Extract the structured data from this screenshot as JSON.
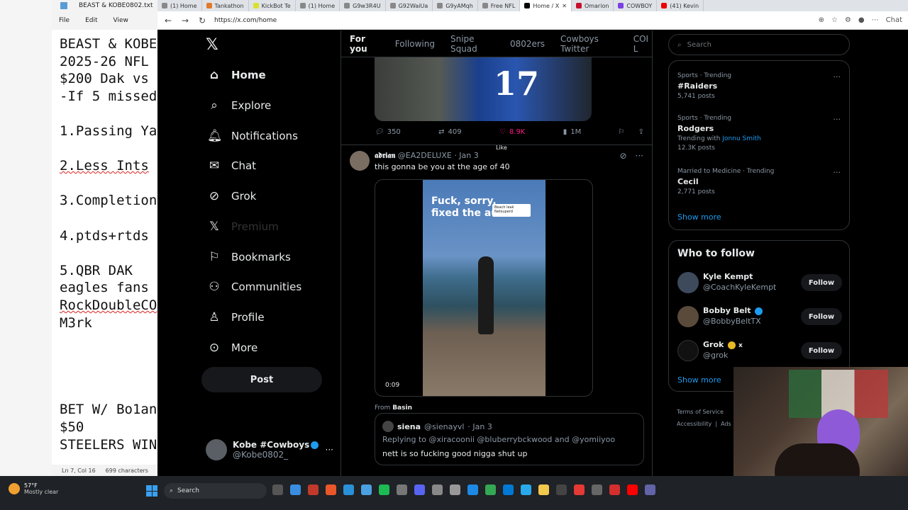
{
  "notepad": {
    "title": "BEAST & KOBE0802.txt",
    "menu": [
      "File",
      "Edit",
      "View"
    ],
    "lines": [
      "BEAST & KOBE",
      "2025-26 NFL",
      "$200 Dak vs",
      "",
      "-If 5 missed",
      "",
      "1.Passing Ya",
      "",
      "2.Less Ints",
      "",
      "3.Completion",
      "",
      "4.ptds+rtds",
      "",
      "5.QBR DAK",
      "eagles fans",
      "RockDoubleCO",
      "M3rk",
      "",
      "",
      "",
      "",
      "BET W/ Bo1an",
      "$50",
      "STEELERS WIN"
    ],
    "status_pos": "Ln 7, Col 16",
    "status_chars": "699 characters"
  },
  "browser": {
    "tabs": [
      "(1) Home",
      "Tankathon",
      "KickBot Te",
      "(1) Home",
      "G9w3R4U",
      "G92WaiUa",
      "G9yAMqh",
      "Free NFL",
      "Home / X",
      "Omarion",
      "COWBOY",
      "(41) Kevin"
    ],
    "active_tab_index": 8,
    "url": "https://x.com/home",
    "chat_label": "Chat"
  },
  "x": {
    "nav": [
      {
        "label": "Home",
        "icon": "home-icon"
      },
      {
        "label": "Explore",
        "icon": "search-icon"
      },
      {
        "label": "Notifications",
        "icon": "bell-icon"
      },
      {
        "label": "Chat",
        "icon": "mail-icon"
      },
      {
        "label": "Grok",
        "icon": "grok-icon"
      },
      {
        "label": "Premium",
        "icon": "x-icon"
      },
      {
        "label": "Bookmarks",
        "icon": "bookmark-icon"
      },
      {
        "label": "Communities",
        "icon": "communities-icon"
      },
      {
        "label": "Profile",
        "icon": "profile-icon"
      },
      {
        "label": "More",
        "icon": "more-icon"
      }
    ],
    "post_label": "Post",
    "account": {
      "name": "Kobe #Cowboys",
      "handle": "@Kobe0802_"
    },
    "tabs": [
      "For you",
      "Following",
      "Snipe Squad",
      "0802ers",
      "Cowboys Twitter",
      "COI L"
    ],
    "post1": {
      "jersey_number": "17",
      "replies": "350",
      "reposts": "409",
      "likes": "8.9K",
      "views": "1M",
      "like_tooltip": "Like"
    },
    "post2": {
      "name": "𝖆𝖉𝖗𝖎𝖆𝖓",
      "handle": "@EA2DELUXE",
      "date": "· Jan 3",
      "text": "this gonna be you at the age of 40",
      "video_caption_1": "Fuck, sorry,",
      "video_caption_2": "fixed the audio",
      "video_chip_1": "Beach leak",
      "video_chip_2": "Netsuperd",
      "video_time": "0:09",
      "from_label": "From",
      "from_source": "Basin",
      "quote": {
        "name": "siena",
        "handle": "@sienayvl",
        "date": "· Jan 3",
        "replying": "Replying to @xiracoonii @bluberrybckwood and @yomiiyoo",
        "text": "nett is so fucking good nigga shut up"
      }
    },
    "search_placeholder": "Search",
    "trends": [
      {
        "cat": "Sports · Trending",
        "name": "#Raiders",
        "ctx": "5,741 posts"
      },
      {
        "cat": "Sports · Trending",
        "name": "Rodgers",
        "ctx_prefix": "Trending with",
        "ctx_link": "Jonnu Smith",
        "ctx2": "12.3K posts"
      },
      {
        "cat": "Married to Medicine · Trending",
        "name": "Cecil",
        "ctx": "2,771 posts"
      }
    ],
    "show_more": "Show more",
    "who_to_follow_title": "Who to follow",
    "who_to_follow": [
      {
        "name": "Kyle Kempt",
        "handle": "@CoachKyleKempt",
        "button": "Follow"
      },
      {
        "name": "Bobby Belt",
        "handle": "@BobbyBeltTX",
        "button": "Follow"
      },
      {
        "name": "Grok",
        "handle": "@grok",
        "button": "Follow"
      }
    ],
    "footer": [
      "Terms of Service",
      "Accessibility",
      "Ads"
    ]
  },
  "taskbar": {
    "temp": "57°F",
    "condition": "Mostly clear",
    "search_label": "Search"
  },
  "colors": {
    "accent": "#1d9bf0",
    "like": "#f91880",
    "background": "#000000"
  }
}
